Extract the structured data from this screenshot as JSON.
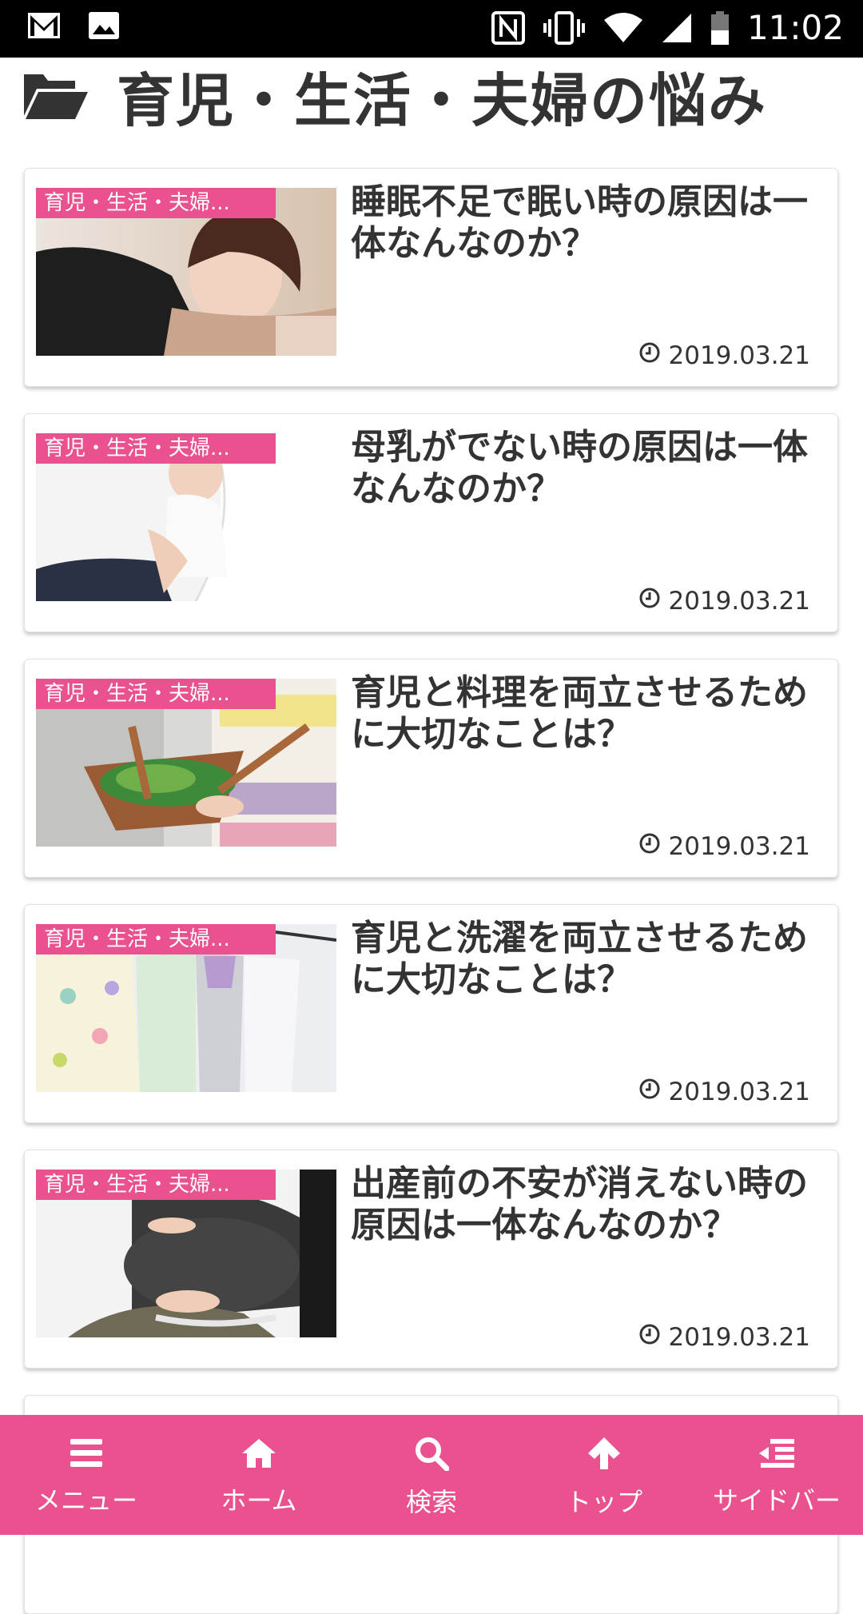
{
  "status_bar": {
    "time": "11:02",
    "left_icons": [
      "gmail-icon",
      "image-icon"
    ],
    "right_icons": [
      "nfc-icon",
      "vibrate-icon",
      "wifi-icon",
      "signal-icon",
      "battery-icon"
    ]
  },
  "page": {
    "title": "育児・生活・夫婦の悩み",
    "title_icon": "folder-open-icon"
  },
  "colors": {
    "accent": "#e9528f",
    "text": "#333333"
  },
  "articles": [
    {
      "category": "育児・生活・夫婦...",
      "title": "睡眠不足で眠い時の原因は一体なんなのか？",
      "date": "2019.03.21"
    },
    {
      "category": "育児・生活・夫婦...",
      "title": "母乳がでない時の原因は一体なんなのか？",
      "date": "2019.03.21"
    },
    {
      "category": "育児・生活・夫婦...",
      "title": "育児と料理を両立させるために大切なことは？",
      "date": "2019.03.21"
    },
    {
      "category": "育児・生活・夫婦...",
      "title": "育児と洗濯を両立させるために大切なことは？",
      "date": "2019.03.21"
    },
    {
      "category": "育児・生活・夫婦...",
      "title": "出産前の不安が消えない時の原因は一体なんなのか？",
      "date": "2019.03.21"
    }
  ],
  "bottom_nav": [
    {
      "label": "メニュー",
      "icon": "menu-icon"
    },
    {
      "label": "ホーム",
      "icon": "home-icon"
    },
    {
      "label": "検索",
      "icon": "search-icon"
    },
    {
      "label": "トップ",
      "icon": "arrow-up-icon"
    },
    {
      "label": "サイドバー",
      "icon": "sidebar-icon"
    }
  ]
}
